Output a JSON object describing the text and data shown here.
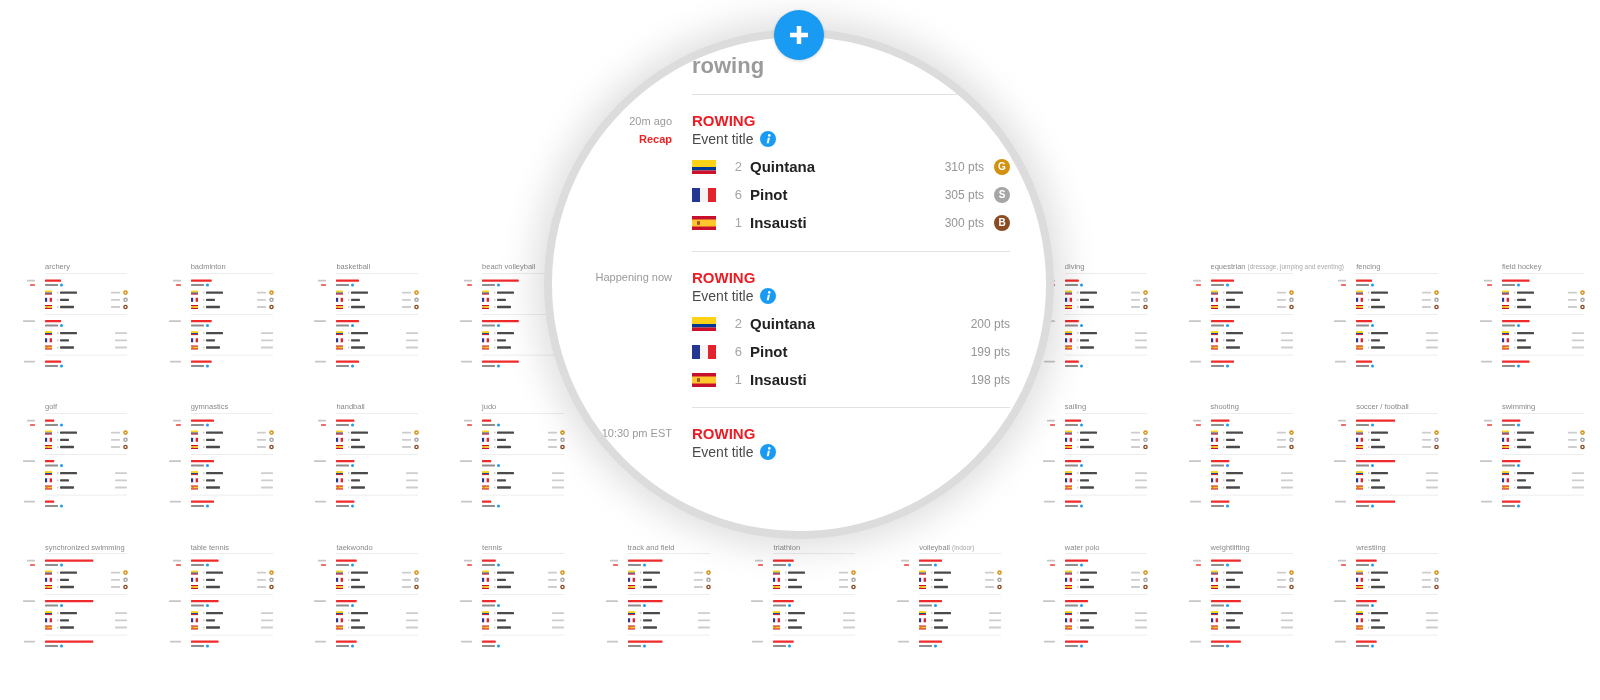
{
  "magnifier": {
    "card": {
      "title": "rowing",
      "events": [
        {
          "time": "20m ago",
          "recap": "Recap",
          "sport": "ROWING",
          "event_title": "Event title",
          "info": true,
          "results": [
            {
              "kind": "colombia",
              "rank": "2",
              "name": "Quintana",
              "pts": "310 pts",
              "medal": "G",
              "color": "#d4900f"
            },
            {
              "kind": "france",
              "rank": "6",
              "name": "Pinot",
              "pts": "305 pts",
              "medal": "S",
              "color": "#a6a6a6"
            },
            {
              "kind": "spain",
              "rank": "1",
              "name": "Insausti",
              "pts": "300 pts",
              "medal": "B",
              "color": "#8b4b23"
            }
          ]
        },
        {
          "time": "Happening now",
          "sport": "ROWING",
          "event_title": "Event title",
          "info": true,
          "results": [
            {
              "kind": "colombia",
              "rank": "2",
              "name": "Quintana",
              "pts": "200 pts"
            },
            {
              "kind": "france",
              "rank": "6",
              "name": "Pinot",
              "pts": "199 pts"
            },
            {
              "kind": "spain",
              "rank": "1",
              "name": "Insausti",
              "pts": "198 pts"
            }
          ]
        },
        {
          "time": "10:30 pm EST",
          "sport": "ROWING",
          "event_title": "Event title",
          "info": true
        }
      ]
    }
  },
  "grid": {
    "rows": [
      {
        "left": [
          {
            "title": "archery"
          },
          {
            "title": "badminton"
          },
          {
            "title": "basketball"
          },
          {
            "title": "beach volleyball"
          }
        ],
        "right": [
          {
            "title": "diving"
          },
          {
            "title": "equestrian",
            "note": "(dressage, jumping and eventing)"
          },
          {
            "title": "fencing"
          },
          {
            "title": "field hockey"
          }
        ]
      },
      {
        "left": [
          {
            "title": "golf"
          },
          {
            "title": "gymnastics"
          },
          {
            "title": "handball"
          },
          {
            "title": "judo"
          }
        ],
        "right": [
          {
            "title": "sailing"
          },
          {
            "title": "shooting"
          },
          {
            "title": "soccer / football"
          },
          {
            "title": "swimming"
          }
        ]
      },
      {
        "left": [
          {
            "title": "synchronized swimming"
          },
          {
            "title": "table tennis"
          },
          {
            "title": "taekwondo"
          },
          {
            "title": "tennis"
          },
          {
            "title": "track and field"
          },
          {
            "title": "triathlon"
          },
          {
            "title": "volleyball",
            "note": "(indoor)"
          },
          {
            "title": "water polo"
          },
          {
            "title": "weightlifting"
          },
          {
            "title": "wrestling"
          }
        ]
      }
    ]
  }
}
